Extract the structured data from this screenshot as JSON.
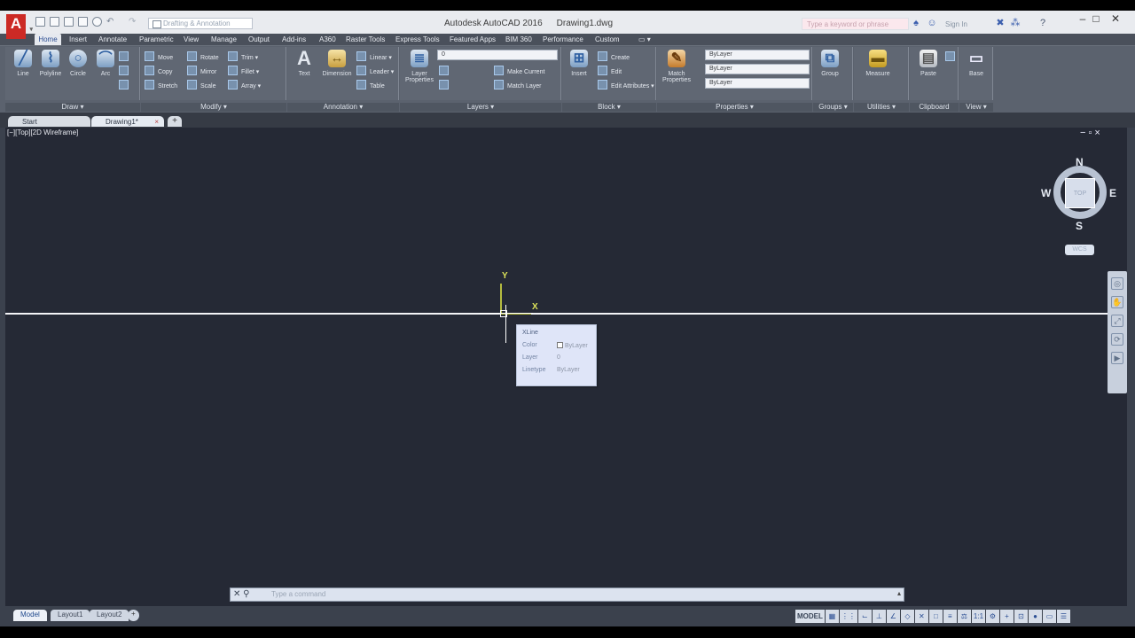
{
  "app": {
    "logo": "A",
    "title": "Autodesk AutoCAD 2016",
    "filename": "Drawing1.dwg",
    "workspace": "Drafting & Annotation",
    "search_placeholder": "Type a keyword or phrase",
    "signin": "Sign In"
  },
  "ribbon_tabs": [
    "Home",
    "Insert",
    "Annotate",
    "Parametric",
    "View",
    "Manage",
    "Output",
    "Add-ins",
    "A360",
    "Raster Tools",
    "Express Tools",
    "Featured Apps",
    "BIM 360",
    "Performance",
    "Custom"
  ],
  "panels": {
    "draw": {
      "label": "Draw ▾",
      "line": "Line",
      "polyline": "Polyline",
      "circle": "Circle",
      "arc": "Arc"
    },
    "modify": {
      "label": "Modify ▾",
      "move": "Move",
      "rotate": "Rotate",
      "trim": "Trim ▾",
      "copy": "Copy",
      "mirror": "Mirror",
      "fillet": "Fillet ▾",
      "stretch": "Stretch",
      "scale": "Scale",
      "array": "Array ▾"
    },
    "annotation": {
      "label": "Annotation ▾",
      "text": "Text",
      "dimension": "Dimension",
      "linear": "Linear ▾",
      "leader": "Leader ▾",
      "table": "Table"
    },
    "layers": {
      "label": "Layers ▾",
      "layer_props": "Layer Properties",
      "current_layer": "0",
      "make_current": "Make Current",
      "match_layer": "Match Layer"
    },
    "block": {
      "label": "Block ▾",
      "insert": "Insert",
      "create": "Create",
      "edit": "Edit",
      "edit_attributes": "Edit Attributes ▾"
    },
    "properties": {
      "label": "Properties ▾",
      "match": "Match Properties",
      "color": "ByLayer",
      "linetype": "ByLayer",
      "lineweight": "ByLayer"
    },
    "groups": {
      "label": "Groups ▾",
      "group": "Group"
    },
    "utilities": {
      "label": "Utilities ▾",
      "measure": "Measure"
    },
    "clipboard": {
      "label": "Clipboard",
      "paste": "Paste"
    },
    "view": {
      "label": "View ▾",
      "base": "Base"
    }
  },
  "file_tabs": [
    "Start",
    "Drawing1*"
  ],
  "viewport": {
    "label": "[−][Top][2D Wireframe]",
    "controls": "− ▫ ×"
  },
  "ucs": {
    "x": "X",
    "y": "Y"
  },
  "tooltip": {
    "title": "XLine",
    "color_label": "Color",
    "color_value": "ByLayer",
    "layer_label": "Layer",
    "layer_value": "0",
    "linetype_label": "Linetype",
    "linetype_value": "ByLayer"
  },
  "viewcube": {
    "n": "N",
    "s": "S",
    "e": "E",
    "w": "W",
    "face": "TOP",
    "wcs": "WCS"
  },
  "command": {
    "placeholder": "Type a command"
  },
  "layout_tabs": [
    "Model",
    "Layout1",
    "Layout2",
    "+"
  ],
  "status": {
    "model": "MODEL",
    "scale": "1:1"
  }
}
